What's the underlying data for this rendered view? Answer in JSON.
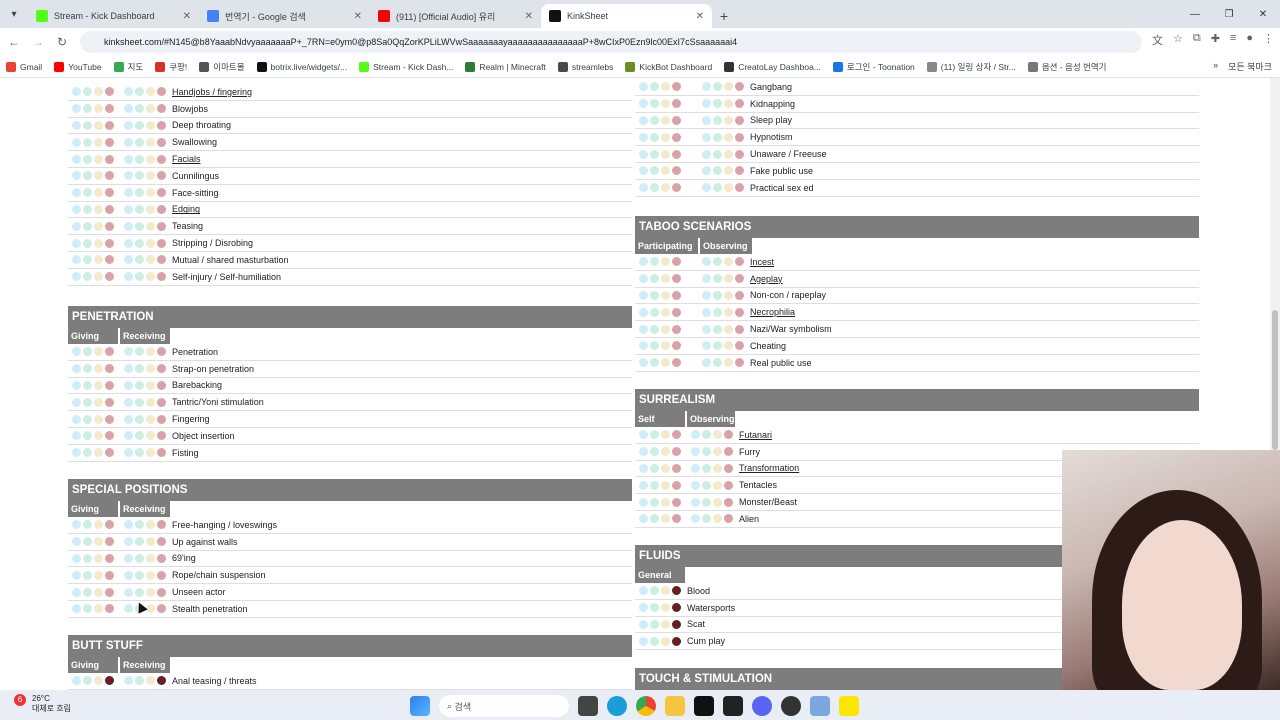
{
  "browser": {
    "tabs": [
      {
        "title": "Stream - Kick Dashboard",
        "color": "#53fc18",
        "active": false
      },
      {
        "title": "번역기 - Google 검색",
        "color": "#4285f4",
        "active": false
      },
      {
        "title": "(911) [Official Audio] 유리",
        "color": "#ff0000",
        "active": false
      },
      {
        "title": "KinkSheet",
        "color": "#111111",
        "active": true
      }
    ],
    "url": "kinksheet.com/#N145@b8YaaabNdvyaaaaaaaP+_7RN=e0ym0@p8Sa0QqZorKPLiLWVwSaaaaaaayaaaaaaaaaaaaaaaP+8wCIxP0Ezn9lc00ExI7cSsaaaaaai4",
    "bookmarks": [
      "Gmail",
      "YouTube",
      "지도",
      "쿠팡!",
      "이마트몰",
      "botrix.live/widgets/...",
      "Stream - Kick Dash...",
      "Realm | Minecraft",
      "streamlebs",
      "KickBot Dashboard",
      "CreatoLay Dashboa...",
      "로그인 - Toonation",
      "(11) 일링 상자 / Str...",
      "옵션 - 음성 번역기"
    ],
    "bookmarks_folder": "모든 북마크"
  },
  "left": {
    "top_rows": [
      {
        "label": "Handjobs / fingering",
        "u": true
      },
      {
        "label": "Blowjobs",
        "u": false
      },
      {
        "label": "Deep throating",
        "u": false
      },
      {
        "label": "Swallowing",
        "u": false
      },
      {
        "label": "Facials",
        "u": true
      },
      {
        "label": "Cunnilingus",
        "u": false
      },
      {
        "label": "Face-sitting",
        "u": false
      },
      {
        "label": "Edging",
        "u": true
      },
      {
        "label": "Teasing",
        "u": false
      },
      {
        "label": "Stripping / Disrobing",
        "u": false
      },
      {
        "label": "Mutual / shared masturbation",
        "u": false
      },
      {
        "label": "Self-injury / Self-humiliation",
        "u": false
      }
    ],
    "penetration": {
      "title": "PENETRATION",
      "col1": "Giving",
      "col2": "Receiving",
      "rows": [
        "Penetration",
        "Strap-on penetration",
        "Barebacking",
        "Tantric/Yoni stimulation",
        "Fingering",
        "Object insertion",
        "Fisting"
      ]
    },
    "special": {
      "title": "SPECIAL POSITIONS",
      "col1": "Giving",
      "col2": "Receiving",
      "rows": [
        "Free-hanging / loveswings",
        "Up against walls",
        "69'ing",
        "Rope/chain suspension",
        "Unseen actor",
        "Stealth penetration"
      ]
    },
    "butt": {
      "title": "BUTT STUFF",
      "col1": "Giving",
      "col2": "Receiving",
      "rows": [
        "Anal teasing / threats"
      ]
    }
  },
  "right": {
    "top_rows": [
      "Gangbang",
      "Kidnapping",
      "Sleep play",
      "Hypnotism",
      "Unaware / Freeuse",
      "Fake public use",
      "Practical sex ed"
    ],
    "taboo": {
      "title": "TABOO SCENARIOS",
      "col1": "Participating",
      "col2": "Observing",
      "rows": [
        {
          "label": "Incest",
          "u": true
        },
        {
          "label": "Ageplay",
          "u": true
        },
        {
          "label": "Non-con / rapeplay",
          "u": false
        },
        {
          "label": "Necrophilia",
          "u": true
        },
        {
          "label": "Nazi/War symbolism",
          "u": false
        },
        {
          "label": "Cheating",
          "u": false
        },
        {
          "label": "Real public use",
          "u": false
        }
      ]
    },
    "surreal": {
      "title": "SURREALISM",
      "col1": "Self",
      "col2": "Observing",
      "rows": [
        {
          "label": "Futanari",
          "u": true
        },
        {
          "label": "Furry",
          "u": false
        },
        {
          "label": "Transformation",
          "u": true
        },
        {
          "label": "Tentacles",
          "u": false
        },
        {
          "label": "Monster/Beast",
          "u": false
        },
        {
          "label": "Alien",
          "u": false
        }
      ]
    },
    "fluids": {
      "title": "FLUIDS",
      "col1": "General",
      "rows": [
        "Blood",
        "Watersports",
        "Scat",
        "Cum play"
      ]
    },
    "touch": {
      "title": "TOUCH & STIMULATION"
    }
  },
  "taskbar": {
    "weather_badge": "6",
    "temp": "26°C",
    "weather_desc": "대체로 흐림",
    "search_placeholder": "검색"
  }
}
